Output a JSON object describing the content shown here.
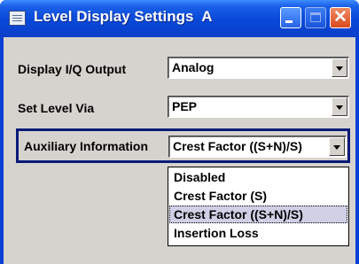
{
  "window": {
    "title": "Level Display Settings  A"
  },
  "form": {
    "display_iq": {
      "label": "Display I/Q Output",
      "value": "Analog"
    },
    "set_level": {
      "label": "Set Level Via",
      "value": "PEP"
    },
    "aux_info": {
      "label": "Auxiliary Information",
      "value": "Crest Factor ((S+N)/S)"
    }
  },
  "dropdown": {
    "options": [
      {
        "label": "Disabled"
      },
      {
        "label": "Crest Factor (S)"
      },
      {
        "label": "Crest Factor ((S+N)/S)"
      },
      {
        "label": "Insertion Loss"
      }
    ]
  }
}
